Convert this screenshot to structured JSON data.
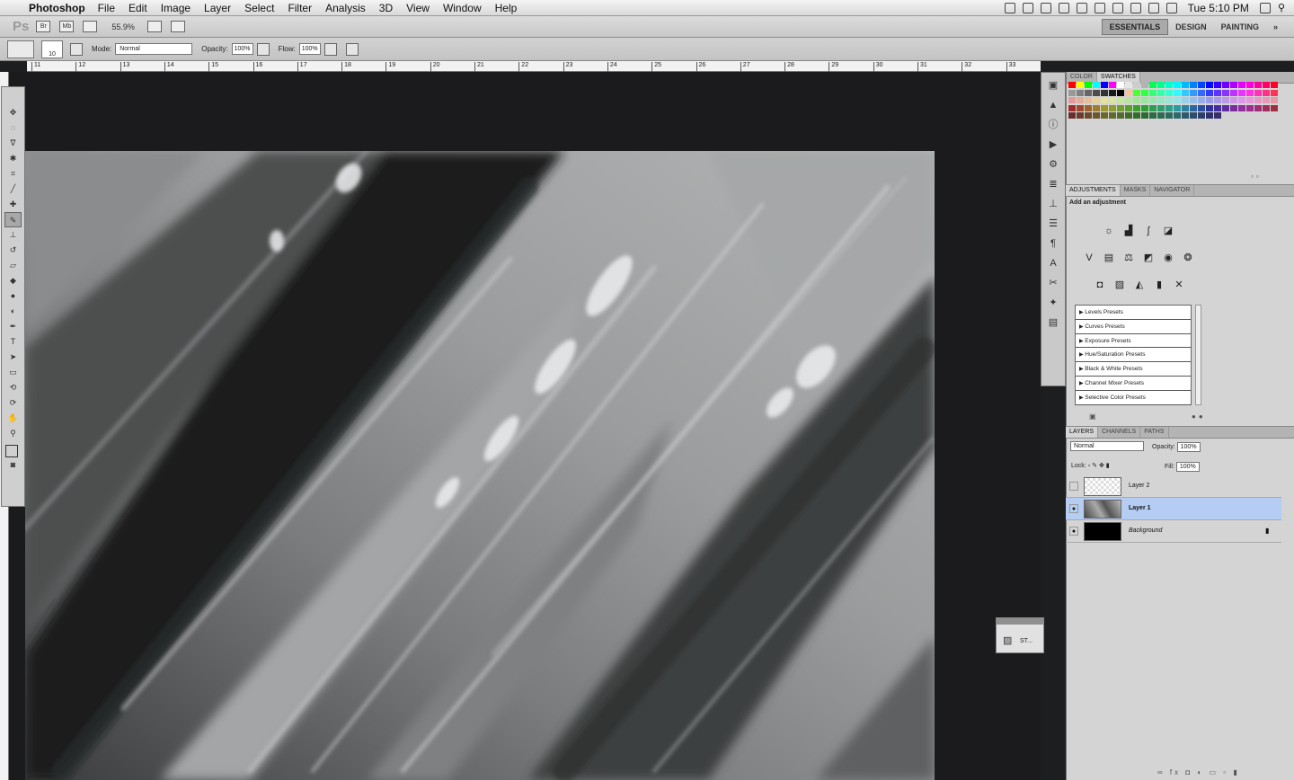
{
  "menubar": {
    "app_name": "Photoshop",
    "items": [
      "File",
      "Edit",
      "Image",
      "Layer",
      "Select",
      "Filter",
      "Analysis",
      "3D",
      "View",
      "Window",
      "Help"
    ],
    "clock": "Tue 5:10 PM"
  },
  "appbar": {
    "logo": "Ps",
    "zoom": "55.9%",
    "workspaces": [
      "ESSENTIALS",
      "DESIGN",
      "PAINTING"
    ],
    "active_workspace": "ESSENTIALS"
  },
  "options": {
    "brush_size": "10",
    "mode_label": "Mode:",
    "mode_value": "Normal",
    "opacity_label": "Opacity:",
    "opacity_value": "100%",
    "flow_label": "Flow:",
    "flow_value": "100%"
  },
  "ruler": {
    "ticks": [
      "11",
      "12",
      "13",
      "14",
      "15",
      "16",
      "17",
      "18",
      "19",
      "20",
      "21",
      "22",
      "23",
      "24",
      "25",
      "26",
      "27",
      "28",
      "29",
      "30",
      "31",
      "32",
      "33"
    ]
  },
  "color_panel": {
    "tabs": [
      "COLOR",
      "SWATCHES"
    ],
    "active_tab": "SWATCHES"
  },
  "adjustments_panel": {
    "tabs": [
      "ADJUSTMENTS",
      "MASKS",
      "NAVIGATOR"
    ],
    "active_tab": "ADJUSTMENTS",
    "heading": "Add an adjustment",
    "presets": [
      "Levels Presets",
      "Curves Presets",
      "Exposure Presets",
      "Hue/Saturation Presets",
      "Black & White Presets",
      "Channel Mixer Presets",
      "Selective Color Presets"
    ]
  },
  "layers_panel": {
    "tabs": [
      "LAYERS",
      "CHANNELS",
      "PATHS"
    ],
    "active_tab": "LAYERS",
    "blend_mode": "Normal",
    "opacity_label": "Opacity:",
    "opacity_value": "100%",
    "lock_label": "Lock:",
    "fill_label": "Fill:",
    "fill_value": "100%",
    "layers": [
      {
        "name": "Layer 2",
        "visible": false,
        "selected": false
      },
      {
        "name": "Layer 1",
        "visible": true,
        "selected": true
      },
      {
        "name": "Background",
        "visible": true,
        "selected": false,
        "locked": true
      }
    ]
  },
  "floating_panel": {
    "label": "ST..."
  },
  "colors": {
    "selection_blue": "#b5cdf3",
    "canvas_dark": "#1b1b1d"
  }
}
